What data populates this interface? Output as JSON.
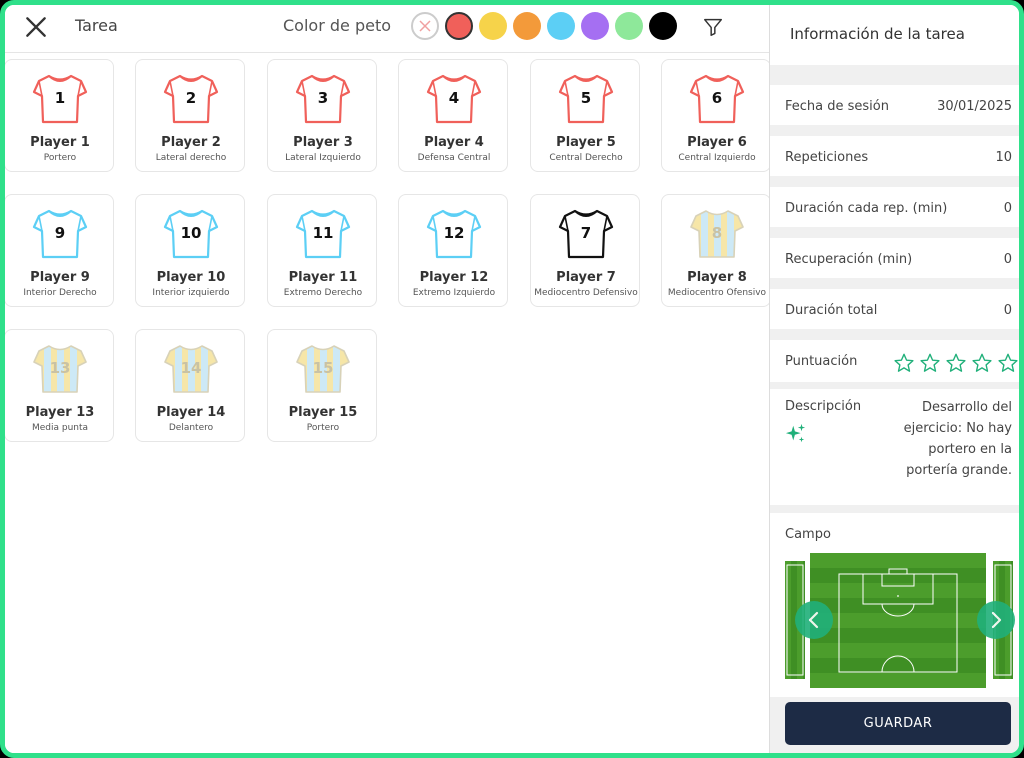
{
  "header": {
    "title": "Tarea",
    "peto_label": "Color de peto",
    "swatches": [
      "none",
      "#f0605a",
      "#f6d34a",
      "#f39a3a",
      "#5ccff5",
      "#a56ff2",
      "#8ee89a",
      "#000000"
    ]
  },
  "players": [
    {
      "number": "1",
      "name": "Player 1",
      "role": "Portero",
      "color": "red"
    },
    {
      "number": "2",
      "name": "Player 2",
      "role": "Lateral derecho",
      "color": "red"
    },
    {
      "number": "3",
      "name": "Player 3",
      "role": "Lateral Izquierdo",
      "color": "red"
    },
    {
      "number": "4",
      "name": "Player 4",
      "role": "Defensa Central",
      "color": "red"
    },
    {
      "number": "5",
      "name": "Player 5",
      "role": "Central Derecho",
      "color": "red"
    },
    {
      "number": "6",
      "name": "Player 6",
      "role": "Central Izquierdo",
      "color": "red"
    },
    {
      "number": "9",
      "name": "Player 9",
      "role": "Interior Derecho",
      "color": "blue"
    },
    {
      "number": "10",
      "name": "Player 10",
      "role": "Interior izquierdo",
      "color": "blue"
    },
    {
      "number": "11",
      "name": "Player 11",
      "role": "Extremo Derecho",
      "color": "blue"
    },
    {
      "number": "12",
      "name": "Player 12",
      "role": "Extremo Izquierdo",
      "color": "blue"
    },
    {
      "number": "7",
      "name": "Player 7",
      "role": "Mediocentro Defensivo",
      "color": "black"
    },
    {
      "number": "8",
      "name": "Player 8",
      "role": "Mediocentro Ofensivo",
      "color": "striped"
    },
    {
      "number": "13",
      "name": "Player 13",
      "role": "Media punta",
      "color": "striped"
    },
    {
      "number": "14",
      "name": "Player 14",
      "role": "Delantero",
      "color": "striped"
    },
    {
      "number": "15",
      "name": "Player 15",
      "role": "Portero",
      "color": "striped"
    }
  ],
  "info": {
    "title": "Información de la tarea",
    "fecha_label": "Fecha de sesión",
    "fecha_value": "30/01/2025",
    "repeticiones_label": "Repeticiones",
    "repeticiones_value": "10",
    "duracion_rep_label": "Duración cada rep. (min)",
    "duracion_rep_value": "0",
    "recuperacion_label": "Recuperación (min)",
    "recuperacion_value": "0",
    "duracion_total_label": "Duración total",
    "duracion_total_value": "0",
    "puntuacion_label": "Puntuación",
    "puntuacion_value": 0,
    "puntuacion_max": 5,
    "descripcion_label": "Descripción",
    "descripcion_value": "Desarrollo del ejercicio: No hay portero en la portería grande.",
    "campo_label": "Campo",
    "save_label": "GUARDAR"
  },
  "colors": {
    "accent": "#2fe08a",
    "star": "#20b07a",
    "save_bg": "#1d2b45",
    "jersey_red": "#f0605a",
    "jersey_blue": "#5ccff5",
    "jersey_black": "#111111",
    "jersey_stripe_a": "#f6e6a8",
    "jersey_stripe_b": "#cde9f6"
  },
  "icons": {
    "close": "close-icon",
    "filter": "filter-icon",
    "sparkle": "sparkle-icon",
    "star": "star-icon",
    "prev": "chevron-left-icon",
    "next": "chevron-right-icon"
  }
}
